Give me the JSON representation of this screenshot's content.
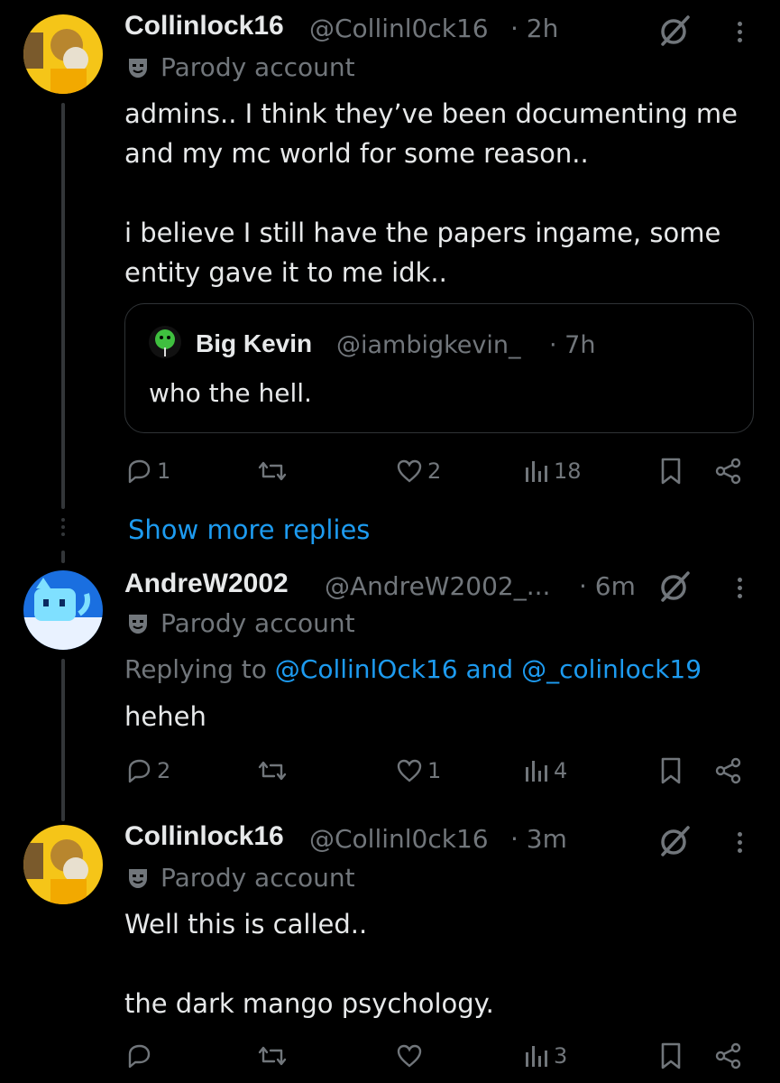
{
  "tweets": [
    {
      "name": "Collinlock16",
      "handle": "@Collinl0ck16",
      "time": "· 2h",
      "label": "Parody account",
      "text": "admins.. I think they’ve been documenting me\nand my mc world for some reason..\n\ni believe I still have the papers ingame, some\nentity gave it to me idk..",
      "quote": {
        "name": "Big Kevin",
        "handle": "@iambigkevin_",
        "time": "· 7h",
        "text": "who the hell."
      },
      "replies": "1",
      "reposts": "",
      "likes": "2",
      "views": "18"
    },
    {
      "name": "AndreW2002",
      "handle": "@AndreW2002_...",
      "time": "· 6m",
      "label": "Parody account",
      "replying_prefix": "Replying to",
      "replying_to": "@CollinlOck16 and @_colinlock19",
      "text": "heheh",
      "replies": "2",
      "reposts": "",
      "likes": "1",
      "views": "4"
    },
    {
      "name": "Collinlock16",
      "handle": "@Collinl0ck16",
      "time": "· 3m",
      "label": "Parody account",
      "text": "Well this is called..\n\nthe dark mango psychology.",
      "replies": "",
      "reposts": "",
      "likes": "",
      "views": "3"
    }
  ],
  "show_more": "Show more replies",
  "icons": [
    "grok-icon",
    "more-icon",
    "parody-mask-icon",
    "reply-icon",
    "repost-icon",
    "like-icon",
    "views-icon",
    "bookmark-icon",
    "share-icon"
  ],
  "colors": {
    "background": "#000000",
    "text": "#e7e9ea",
    "muted": "#71767b",
    "link": "#1d9bf0"
  }
}
